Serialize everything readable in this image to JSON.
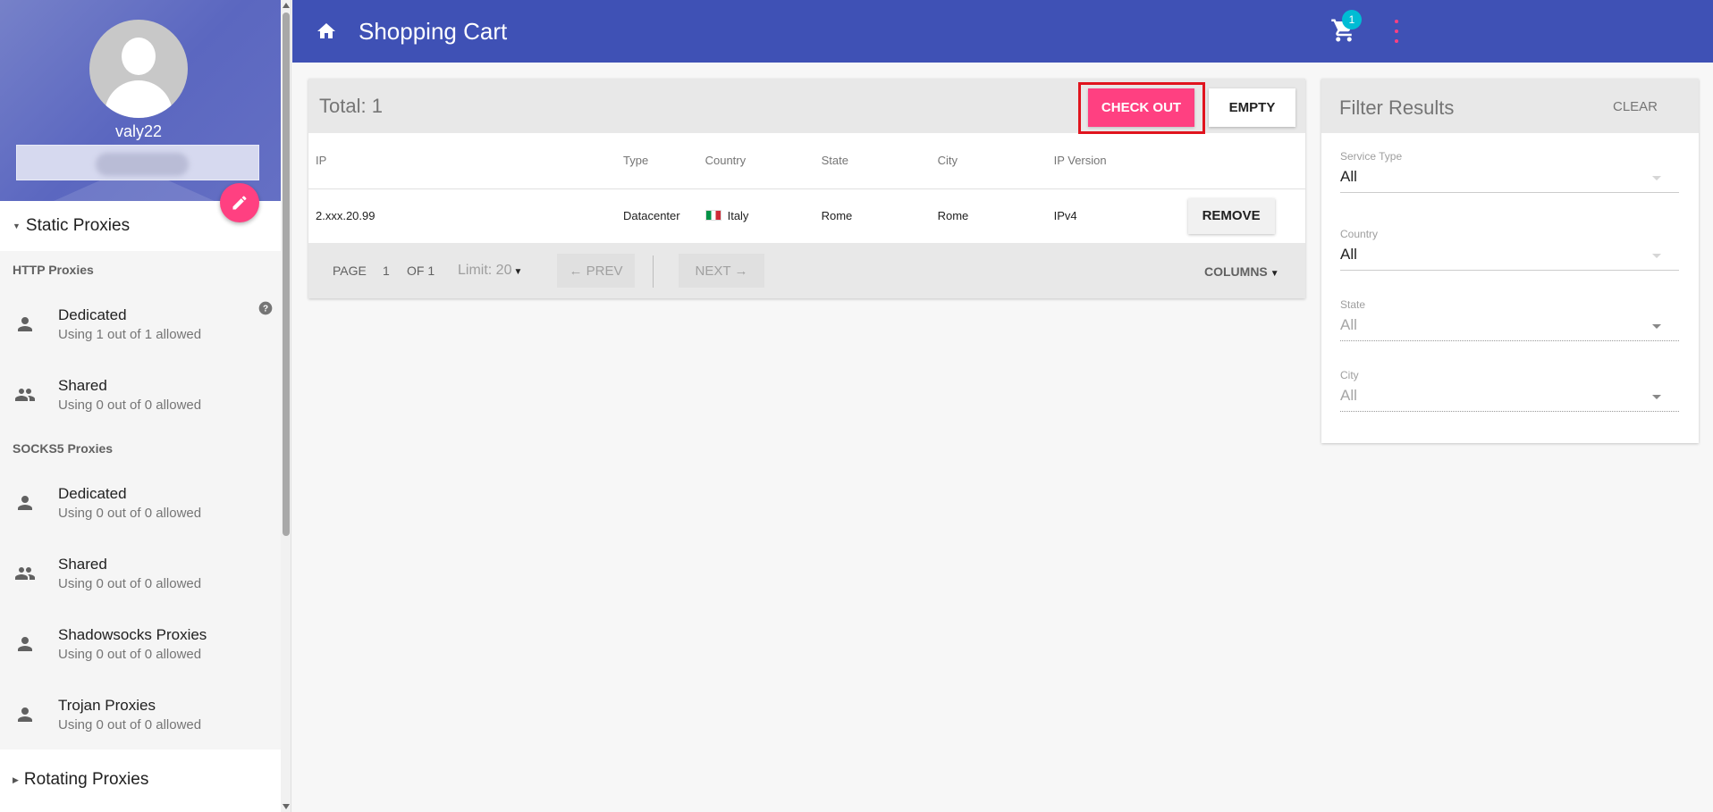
{
  "sidebar": {
    "username": "valy22",
    "static_section": "Static Proxies",
    "rotating_section": "Rotating Proxies",
    "http_group": "HTTP Proxies",
    "socks_group": "SOCKS5 Proxies",
    "http_items": [
      {
        "title": "Dedicated",
        "subtitle": "Using 1 out of 1 allowed",
        "icon": "person-icon"
      },
      {
        "title": "Shared",
        "subtitle": "Using 0 out of 0 allowed",
        "icon": "group-icon"
      }
    ],
    "socks_items": [
      {
        "title": "Dedicated",
        "subtitle": "Using 0 out of 0 allowed",
        "icon": "person-icon"
      },
      {
        "title": "Shared",
        "subtitle": "Using 0 out of 0 allowed",
        "icon": "group-icon"
      },
      {
        "title": "Shadowsocks Proxies",
        "subtitle": "Using 0 out of 0 allowed",
        "icon": "person-icon"
      },
      {
        "title": "Trojan Proxies",
        "subtitle": "Using 0 out of 0 allowed",
        "icon": "person-icon"
      }
    ]
  },
  "header": {
    "title": "Shopping Cart",
    "cart_count": "1",
    "colors": {
      "bar": "#3f51b5",
      "badge": "#00bcd4",
      "accent": "#ff4081"
    }
  },
  "cart": {
    "total": "Total: 1",
    "checkout_label": "CHECK OUT",
    "empty_label": "EMPTY",
    "columns": [
      "IP",
      "Type",
      "Country",
      "State",
      "City",
      "IP Version"
    ],
    "rows": [
      {
        "ip": "2.xxx.20.99",
        "type": "Datacenter",
        "country": "Italy",
        "state": "Rome",
        "city": "Rome",
        "ip_version": "IPv4",
        "action": "REMOVE"
      }
    ],
    "pager": {
      "page_label": "PAGE",
      "page": "1",
      "of_label": "OF 1",
      "limit": "Limit: 20",
      "prev": "← PREV",
      "next": "NEXT →",
      "columns_label": "COLUMNS"
    }
  },
  "filter": {
    "title": "Filter Results",
    "clear_label": "CLEAR",
    "fields": [
      {
        "label": "Service Type",
        "value": "All"
      },
      {
        "label": "Country",
        "value": "All"
      },
      {
        "label": "State",
        "value": "All"
      },
      {
        "label": "City",
        "value": "All"
      }
    ]
  }
}
